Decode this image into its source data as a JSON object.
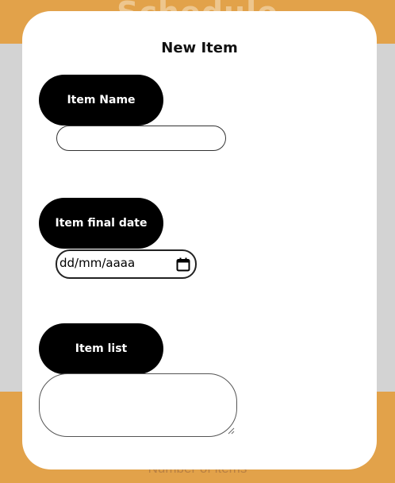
{
  "background": {
    "header_title": "Schedule",
    "footer_text": "Number of items"
  },
  "modal": {
    "title": "New Item",
    "fields": [
      {
        "label": "Item Name",
        "value": ""
      },
      {
        "label": "Item final date",
        "placeholder": "dd/mm/aaaa"
      },
      {
        "label": "Item list",
        "value": ""
      }
    ]
  },
  "colors": {
    "accent": "#e2a24a",
    "backdrop": "#d3d3d3",
    "pill": "#000000"
  },
  "icons": [
    "calendar-icon",
    "resize-handle-icon"
  ]
}
